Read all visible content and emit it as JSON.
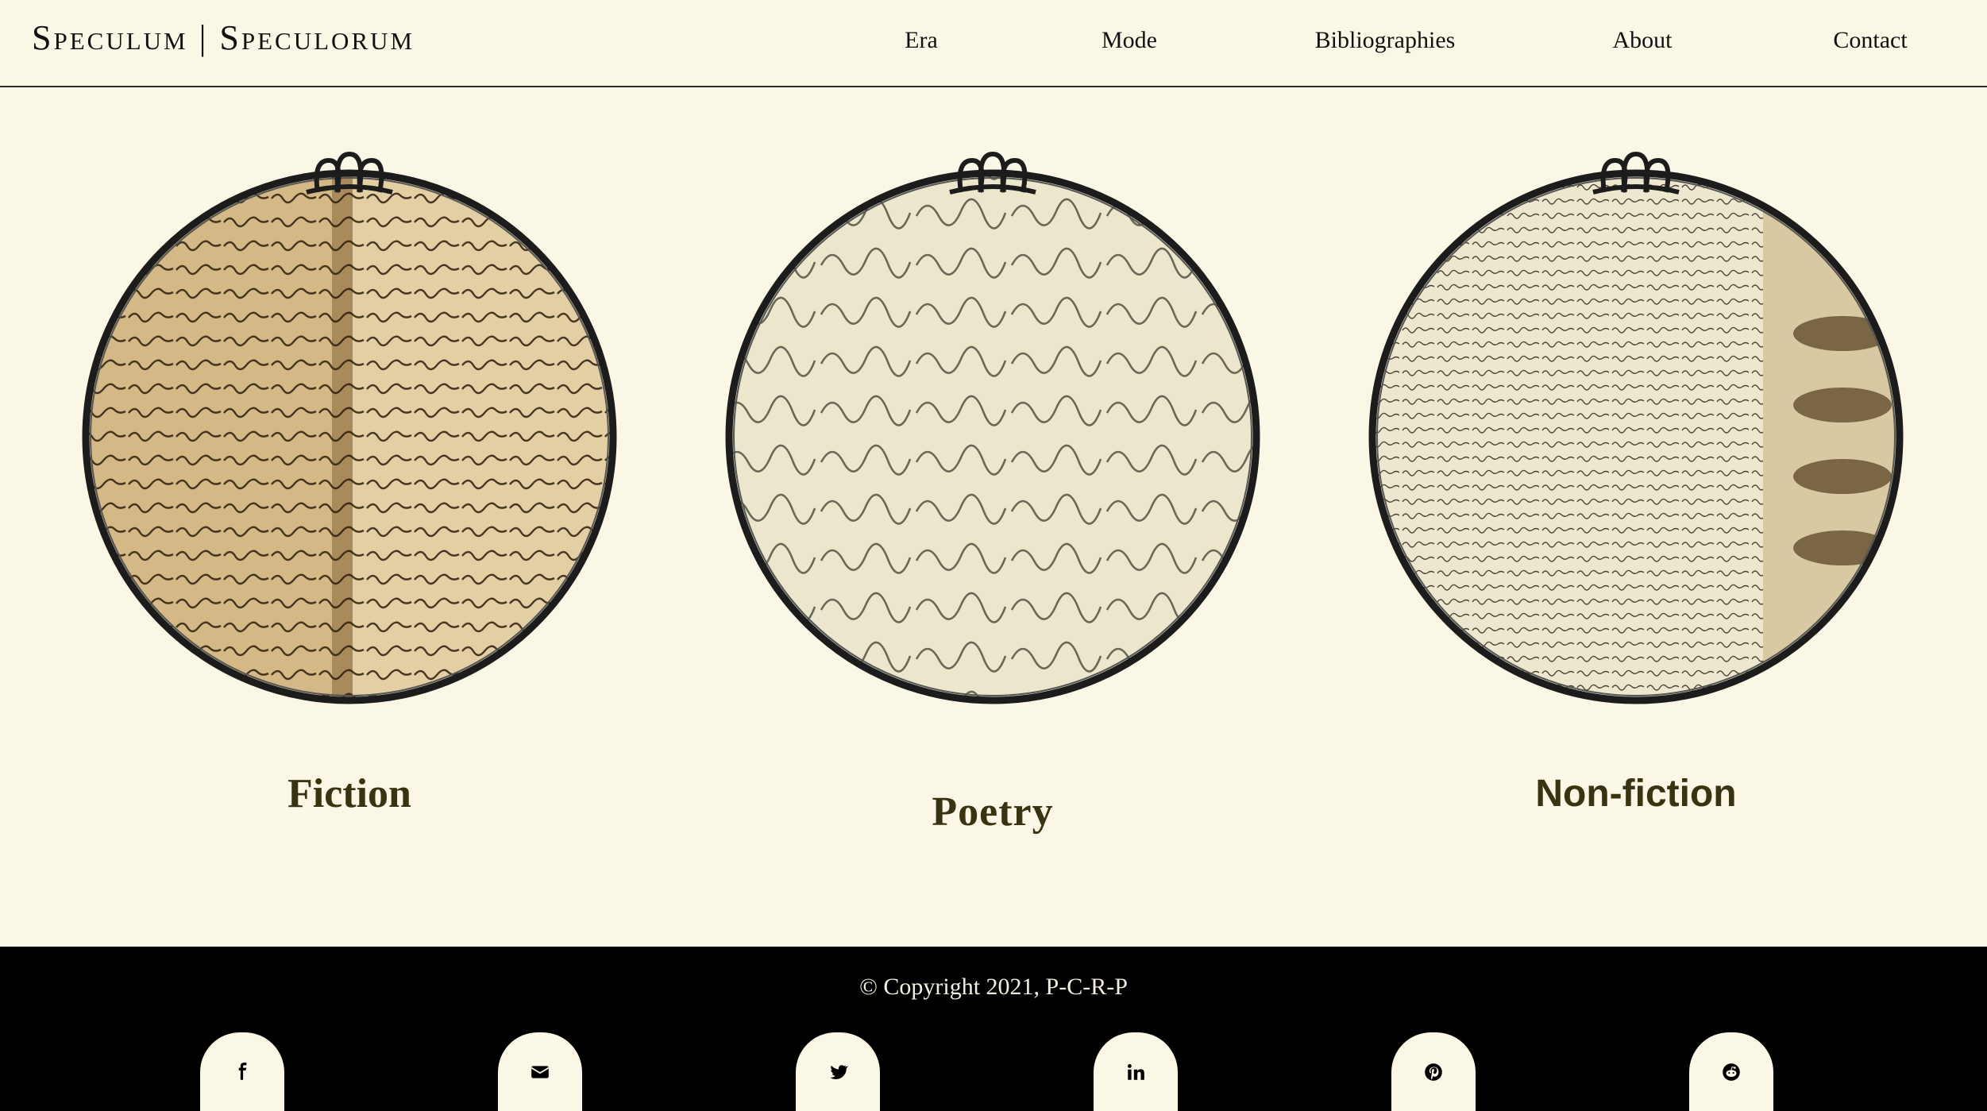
{
  "brand": {
    "title": "Speculum | Speculorum"
  },
  "nav": {
    "items": [
      {
        "label": "Era"
      },
      {
        "label": "Mode"
      },
      {
        "label": "Bibliographies"
      },
      {
        "label": "About"
      },
      {
        "label": "Contact"
      }
    ]
  },
  "categories": [
    {
      "label": "Fiction",
      "image": "handwritten-spanish-manuscript"
    },
    {
      "label": "Poetry",
      "image": "handwritten-poem-manuscript"
    },
    {
      "label": "Non-fiction",
      "image": "codex-mirror-writing-sketches"
    }
  ],
  "footer": {
    "copyright": "© Copyright 2021, P-C-R-P",
    "social": [
      {
        "icon": "facebook-icon"
      },
      {
        "icon": "envelope-icon"
      },
      {
        "icon": "twitter-icon"
      },
      {
        "icon": "linkedin-icon"
      },
      {
        "icon": "pinterest-icon"
      },
      {
        "icon": "reddit-icon"
      }
    ]
  },
  "colors": {
    "background": "#faf7e6",
    "footer": "#000000",
    "caption": "#3a3312",
    "frame": "#1c1c1c"
  }
}
